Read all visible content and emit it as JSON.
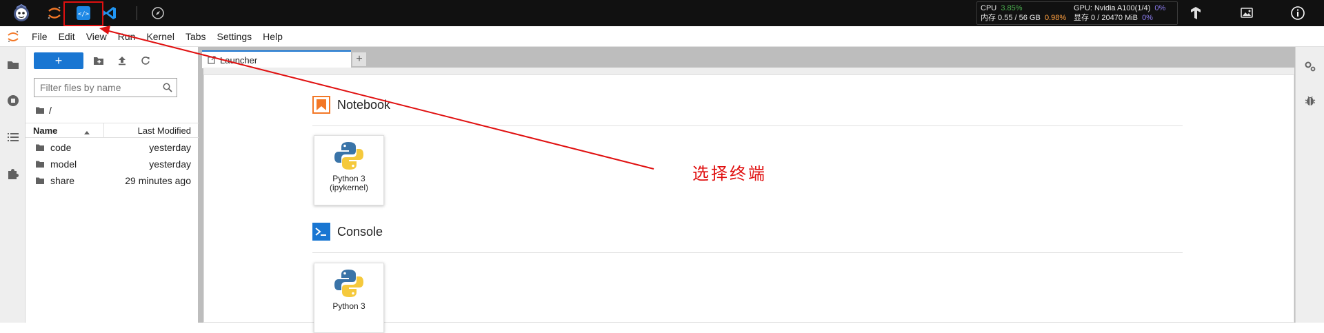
{
  "topbar": {
    "apps": [
      {
        "name": "jupyter-robot-logo"
      },
      {
        "name": "jupyter-lab-app"
      },
      {
        "name": "code-editor-app"
      },
      {
        "name": "vscode-app"
      }
    ],
    "monitor": {
      "cpu_label": "CPU",
      "cpu_value": "3.85%",
      "gpu_label": "GPU: Nvidia A100(1/4)",
      "gpu_value": "0%",
      "mem_label": "内存 0.55 / 56 GB",
      "mem_value": "0.98%",
      "vram_label": "显存 0 / 20470 MiB",
      "vram_value": "0%"
    }
  },
  "menubar": {
    "items": [
      "File",
      "Edit",
      "View",
      "Run",
      "Kernel",
      "Tabs",
      "Settings",
      "Help"
    ]
  },
  "filebrowser": {
    "new_label": "+",
    "filter_placeholder": "Filter files by name",
    "breadcrumb": "/",
    "col_name": "Name",
    "col_modified": "Last Modified",
    "rows": [
      {
        "name": "code",
        "modified": "yesterday"
      },
      {
        "name": "model",
        "modified": "yesterday"
      },
      {
        "name": "share",
        "modified": "29 minutes ago"
      }
    ]
  },
  "dock": {
    "tab_label": "Launcher",
    "tab_add": "+",
    "notebook_title": "Notebook",
    "console_title": "Console",
    "notebook_card": {
      "line1": "Python 3",
      "line2": "(ipykernel)"
    },
    "console_card": {
      "line1": "Python 3"
    }
  },
  "annotation": {
    "text": "选择终端",
    "color": "#e01010"
  },
  "colors": {
    "accent": "#1976d2",
    "notebook_orange": "#f37726",
    "console_blue": "#1976d2"
  }
}
